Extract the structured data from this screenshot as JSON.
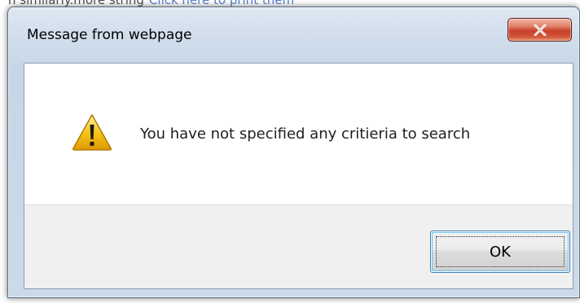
{
  "background_page": {
    "text": "n similarly.more string",
    "link_text": "Click here to print them"
  },
  "dialog": {
    "title": "Message from webpage",
    "close_label": "×",
    "icon": "warning-icon",
    "message": "You have not specified any critieria to search",
    "ok_label": "OK"
  },
  "colors": {
    "close_button": "#c9412a",
    "warning_yellow": "#f5c518",
    "ok_focus_border": "#3c7fb1",
    "button_strip": "#f0f0f0"
  }
}
